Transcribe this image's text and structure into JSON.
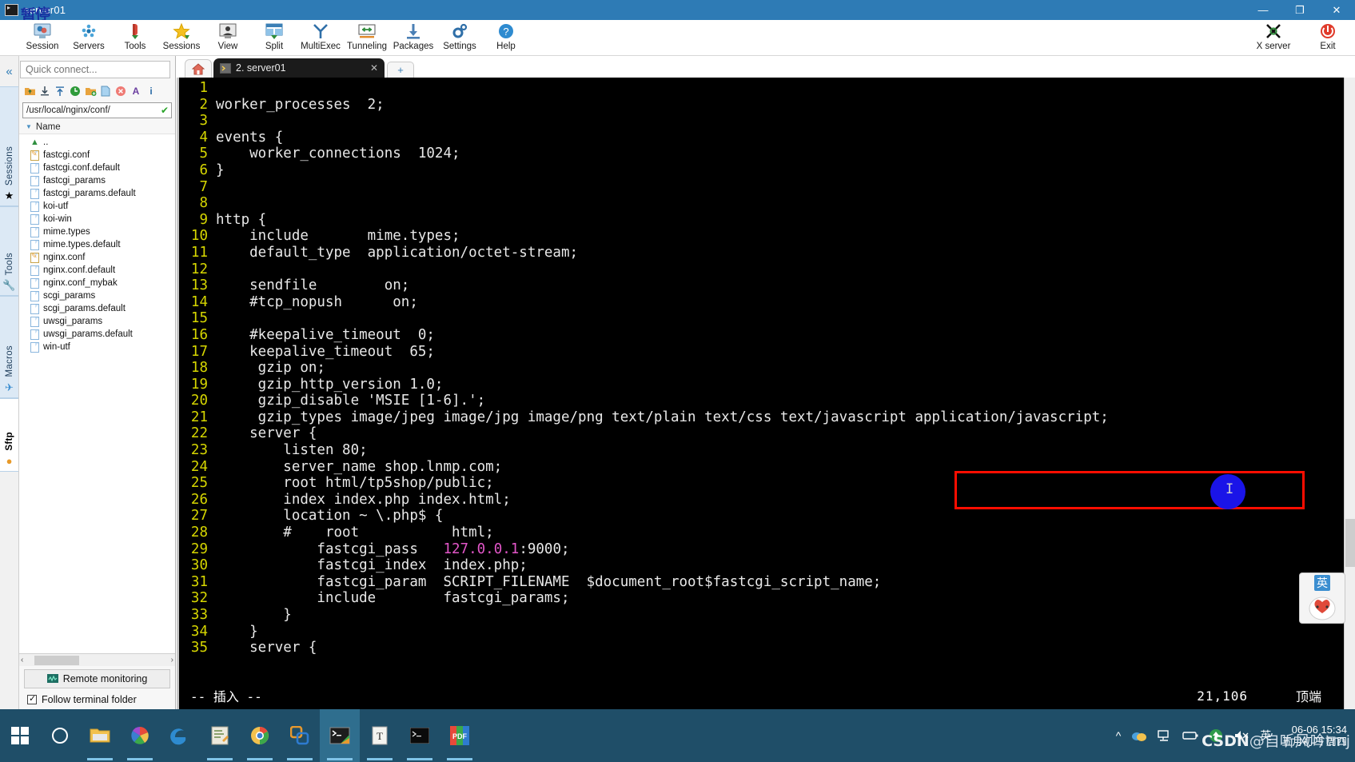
{
  "window": {
    "title": "server01",
    "overlay_stamp": "暂停",
    "controls": {
      "minimize": "—",
      "maximize": "❐",
      "close": "✕"
    }
  },
  "ribbon": {
    "items": [
      {
        "label": "Session",
        "icon": "session-icon"
      },
      {
        "label": "Servers",
        "icon": "servers-icon"
      },
      {
        "label": "Tools",
        "icon": "tools-icon"
      },
      {
        "label": "Sessions",
        "icon": "sessions-star-icon"
      },
      {
        "label": "View",
        "icon": "view-icon"
      },
      {
        "label": "Split",
        "icon": "split-icon"
      },
      {
        "label": "MultiExec",
        "icon": "multiexec-icon"
      },
      {
        "label": "Tunneling",
        "icon": "tunneling-icon"
      },
      {
        "label": "Packages",
        "icon": "packages-icon"
      },
      {
        "label": "Settings",
        "icon": "settings-gear-icon"
      },
      {
        "label": "Help",
        "icon": "help-icon"
      }
    ],
    "right_items": [
      {
        "label": "X server",
        "icon": "x-server-icon"
      },
      {
        "label": "Exit",
        "icon": "power-exit-icon"
      }
    ]
  },
  "rail": {
    "collapse": "«",
    "tabs": [
      {
        "label": "Sessions",
        "icon": "star-icon"
      },
      {
        "label": "Tools",
        "icon": "wrench-icon"
      },
      {
        "label": "Macros",
        "icon": "paper-plane-icon"
      },
      {
        "label": "Sftp",
        "icon": "globe-icon"
      }
    ]
  },
  "sidebar": {
    "quick_connect_placeholder": "Quick connect...",
    "toolbar_icons": [
      "upload-parent-folder-icon",
      "download-icon",
      "upload-icon",
      "refresh-icon",
      "new-folder-icon",
      "new-file-icon",
      "delete-icon",
      "text-mode-icon",
      "info-icon"
    ],
    "path": "/usr/local/nginx/conf/",
    "path_status": "✔",
    "column_header": "Name",
    "files": [
      {
        "name": "..",
        "type": "parent"
      },
      {
        "name": "fastcgi.conf",
        "type": "edited"
      },
      {
        "name": "fastcgi.conf.default",
        "type": "file"
      },
      {
        "name": "fastcgi_params",
        "type": "file"
      },
      {
        "name": "fastcgi_params.default",
        "type": "file"
      },
      {
        "name": "koi-utf",
        "type": "file"
      },
      {
        "name": "koi-win",
        "type": "file"
      },
      {
        "name": "mime.types",
        "type": "file"
      },
      {
        "name": "mime.types.default",
        "type": "file"
      },
      {
        "name": "nginx.conf",
        "type": "edited"
      },
      {
        "name": "nginx.conf.default",
        "type": "file"
      },
      {
        "name": "nginx.conf_mybak",
        "type": "file"
      },
      {
        "name": "scgi_params",
        "type": "file"
      },
      {
        "name": "scgi_params.default",
        "type": "file"
      },
      {
        "name": "uwsgi_params",
        "type": "file"
      },
      {
        "name": "uwsgi_params.default",
        "type": "file"
      },
      {
        "name": "win-utf",
        "type": "file"
      }
    ],
    "scroll_left": "‹",
    "scroll_right": "›",
    "remote_monitoring": "Remote monitoring",
    "follow_terminal_folder": "Follow terminal folder"
  },
  "tabs": {
    "home_icon": "home-icon",
    "terminal_tab": {
      "label": "2. server01",
      "close": "✕",
      "icon": "terminal-tab-icon"
    },
    "new_tab": "+"
  },
  "terminal": {
    "lines": [
      {
        "no": "1",
        "text": ""
      },
      {
        "no": "2",
        "text": "worker_processes  2;"
      },
      {
        "no": "3",
        "text": ""
      },
      {
        "no": "4",
        "text": "events {"
      },
      {
        "no": "5",
        "text": "    worker_connections  1024;"
      },
      {
        "no": "6",
        "text": "}"
      },
      {
        "no": "7",
        "text": ""
      },
      {
        "no": "8",
        "text": ""
      },
      {
        "no": "9",
        "text": "http {"
      },
      {
        "no": "10",
        "text": "    include       mime.types;"
      },
      {
        "no": "11",
        "text": "    default_type  application/octet-stream;"
      },
      {
        "no": "12",
        "text": ""
      },
      {
        "no": "13",
        "text": "    sendfile        on;"
      },
      {
        "no": "14",
        "text": "    #tcp_nopush      on;"
      },
      {
        "no": "15",
        "text": ""
      },
      {
        "no": "16",
        "text": "    #keepalive_timeout  0;"
      },
      {
        "no": "17",
        "text": "    keepalive_timeout  65;"
      },
      {
        "no": "18",
        "text": "     gzip on;"
      },
      {
        "no": "19",
        "text": "     gzip_http_version 1.0;"
      },
      {
        "no": "20",
        "text": "     gzip_disable 'MSIE [1-6].';"
      },
      {
        "no": "21",
        "text": "     gzip_types image/jpeg image/jpg image/png text/plain text/css text/javascript application/javascript;"
      },
      {
        "no": "22",
        "text": "    server {"
      },
      {
        "no": "23",
        "text": "        listen 80;"
      },
      {
        "no": "24",
        "text": "        server_name shop.lnmp.com;"
      },
      {
        "no": "25",
        "text": "        root html/tp5shop/public;"
      },
      {
        "no": "26",
        "text": "        index index.php index.html;"
      },
      {
        "no": "27",
        "text": "        location ~ \\.php$ {"
      },
      {
        "no": "28",
        "text": "        #    root           html;"
      },
      {
        "no": "29",
        "text": "            fastcgi_pass   127.0.0.1:9000;",
        "highlight": "127.0.0.1"
      },
      {
        "no": "30",
        "text": "            fastcgi_index  index.php;"
      },
      {
        "no": "31",
        "text": "            fastcgi_param  SCRIPT_FILENAME  $document_root$fastcgi_script_name;"
      },
      {
        "no": "32",
        "text": "            include        fastcgi_params;"
      },
      {
        "no": "33",
        "text": "        }"
      },
      {
        "no": "34",
        "text": "    }"
      },
      {
        "no": "35",
        "text": "    server {"
      }
    ],
    "status": {
      "mode": "-- 插入 --",
      "position": "21,106",
      "scroll": "顶端"
    },
    "annotation_text": "text/javascript application/javascript;",
    "annotation_color": "#ff0d00",
    "cursor_color": "#1a14e8"
  },
  "ime_widget": {
    "mode_label": "英",
    "face": "❀"
  },
  "taskbar": {
    "start_icon": "windows-start-icon",
    "apps": [
      {
        "name": "cortana-icon",
        "active": false,
        "running": false
      },
      {
        "name": "file-explorer-icon",
        "active": false,
        "running": true
      },
      {
        "name": "color-wheel-icon",
        "active": false,
        "running": true
      },
      {
        "name": "edge-icon",
        "active": false,
        "running": false
      },
      {
        "name": "notes-app-icon",
        "active": false,
        "running": true
      },
      {
        "name": "chrome-icon",
        "active": false,
        "running": true
      },
      {
        "name": "vmware-icon",
        "active": false,
        "running": true
      },
      {
        "name": "mobaxterm-icon",
        "active": true,
        "running": true
      },
      {
        "name": "typora-icon",
        "active": false,
        "running": true
      },
      {
        "name": "console-icon",
        "active": false,
        "running": true
      },
      {
        "name": "pdf-icon",
        "active": false,
        "running": true
      }
    ],
    "tray": {
      "chevron": "^",
      "icons": [
        "cloud-icon",
        "network-icon",
        "battery-icon",
        "update-icon",
        "volume-muted-icon"
      ],
      "ime": "英",
      "date": "06-06 15:34",
      "lunar": "五月初四 周四"
    },
    "watermark": {
      "prefix": "CSDN",
      "suffix": "@自听风吟tmj"
    }
  }
}
